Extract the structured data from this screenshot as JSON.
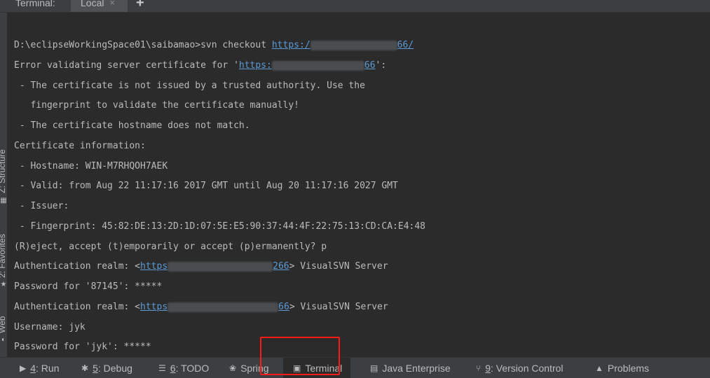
{
  "tabbar": {
    "title": "Terminal:",
    "tab_label": "Local",
    "close_glyph": "×",
    "add_glyph": "+"
  },
  "gutter": {
    "structure_label": "Z: Structure",
    "favorites_label": "2: Favorites",
    "web_label": "Web"
  },
  "terminal": {
    "l1_prefix": "D:\\eclipseWorkingSpace01\\saibamao>svn checkout ",
    "l1_link_a": "https:/",
    "l1_link_b": "66/",
    "l2_prefix": "Error validating server certificate for '",
    "l2_link_a": "https:",
    "l2_link_b": "66",
    "l2_suffix": "':",
    "l3": " - The certificate is not issued by a trusted authority. Use the",
    "l4": "   fingerprint to validate the certificate manually!",
    "l5": " - The certificate hostname does not match.",
    "l6": "Certificate information:",
    "l7": " - Hostname: WIN-M7RHQOH7AEK",
    "l8": " - Valid: from Aug 22 11:17:16 2017 GMT until Aug 20 11:17:16 2027 GMT",
    "l9": " - Issuer:",
    "l10": " - Fingerprint: 45:82:DE:13:2D:1D:07:5E:E5:90:37:44:4F:22:75:13:CD:CA:E4:48",
    "l11": "(R)eject, accept (t)emporarily or accept (p)ermanently? p",
    "l12_prefix": "Authentication realm: <",
    "l12_link_a": "https",
    "l12_link_b": "266",
    "l12_suffix": "> VisualSVN Server",
    "l13": "Password for '87145': *****",
    "l14_prefix": "Authentication realm: <",
    "l14_link_a": "https",
    "l14_link_b": "66",
    "l14_suffix": "> VisualSVN Server",
    "l15": "Username: jyk",
    "l16": "Password for 'jyk': *****"
  },
  "bottombar": {
    "run": {
      "num": "4",
      "label": ": Run"
    },
    "debug": {
      "num": "5",
      "label": ": Debug"
    },
    "todo": {
      "num": "6",
      "label": ": TODO"
    },
    "spring": {
      "label": "Spring"
    },
    "terminal": {
      "label": "Terminal"
    },
    "java_ee": {
      "label": "Java Enterprise"
    },
    "vcs": {
      "num": "9",
      "label": ": Version Control"
    },
    "problems": {
      "label": "Problems"
    }
  },
  "colors": {
    "background": "#2b2b2b",
    "panel": "#3c3f41",
    "link": "#5c9bd6",
    "highlight": "#ff1a1a"
  }
}
